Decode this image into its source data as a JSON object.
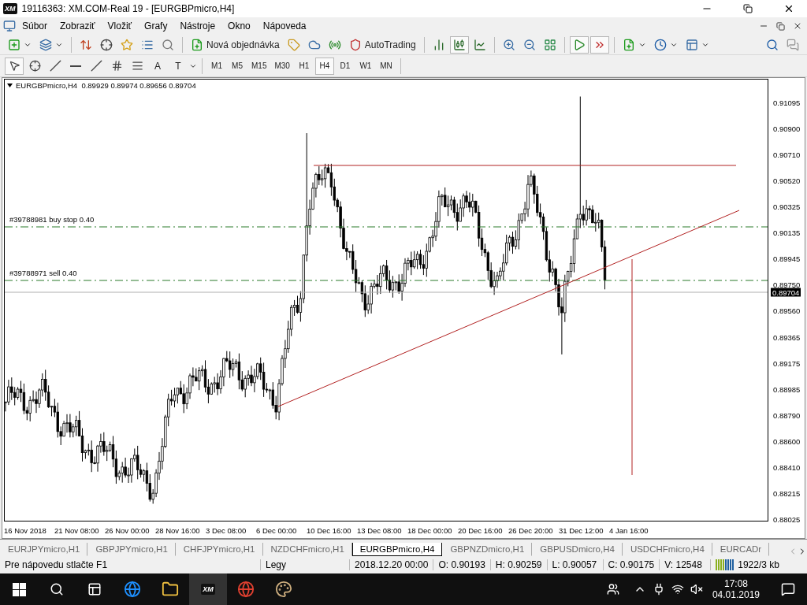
{
  "window": {
    "logo": "XM",
    "title": "19116363: XM.COM-Real 19 - [EURGBPmicro,H4]"
  },
  "menu": [
    "Súbor",
    "Zobraziť",
    "Vložiť",
    "Grafy",
    "Nástroje",
    "Okno",
    "Nápoveda"
  ],
  "toolbar": {
    "new_order": "Nová objednávka",
    "auto_trading": "AutoTrading"
  },
  "chart_types": [
    {
      "kind": "bars",
      "selected": false
    },
    {
      "kind": "candles",
      "selected": true
    },
    {
      "kind": "line",
      "selected": false
    }
  ],
  "drawing_tools": [
    {
      "kind": "cursor",
      "selected": true
    },
    {
      "kind": "crosshair",
      "selected": false
    },
    {
      "kind": "vline",
      "selected": false
    },
    {
      "kind": "hline",
      "selected": false
    },
    {
      "kind": "trend",
      "selected": false
    },
    {
      "kind": "channel",
      "selected": false
    },
    {
      "kind": "fibo",
      "selected": false
    },
    {
      "kind": "text",
      "label": "A",
      "selected": false
    },
    {
      "kind": "label",
      "label": "T",
      "selected": false
    }
  ],
  "timeframes": [
    {
      "label": "M1",
      "selected": false
    },
    {
      "label": "M5",
      "selected": false
    },
    {
      "label": "M15",
      "selected": false
    },
    {
      "label": "M30",
      "selected": false
    },
    {
      "label": "H1",
      "selected": false
    },
    {
      "label": "H4",
      "selected": true
    },
    {
      "label": "D1",
      "selected": false
    },
    {
      "label": "W1",
      "selected": false
    },
    {
      "label": "MN",
      "selected": false
    }
  ],
  "chart": {
    "symbol": "EURGBPmicro,H4",
    "ohlc": "0.89929 0.89974 0.89656 0.89704",
    "orders": [
      {
        "label": "#39788981 buy stop 0.40"
      },
      {
        "label": "#39788971 sell 0.40"
      }
    ],
    "price_ticks": [
      "0.91095",
      "0.90900",
      "0.90710",
      "0.90520",
      "0.90325",
      "0.90135",
      "0.89945",
      "0.89750",
      "0.89560",
      "0.89365",
      "0.89175",
      "0.88985",
      "0.88790",
      "0.88600",
      "0.88410",
      "0.88215",
      "0.88025"
    ],
    "current_price": "0.89704",
    "date_labels": [
      "16 Nov 2018",
      "21 Nov 08:00",
      "26 Nov 00:00",
      "28 Nov 16:00",
      "3 Dec 08:00",
      "6 Dec 00:00",
      "10 Dec 16:00",
      "13 Dec 08:00",
      "18 Dec 00:00",
      "20 Dec 16:00",
      "26 Dec 20:00",
      "31 Dec 12:00",
      "4 Jan 16:00"
    ]
  },
  "tabs": [
    {
      "label": "EURJPYmicro,H1",
      "selected": false
    },
    {
      "label": "GBPJPYmicro,H1",
      "selected": false
    },
    {
      "label": "CHFJPYmicro,H1",
      "selected": false
    },
    {
      "label": "NZDCHFmicro,H1",
      "selected": false
    },
    {
      "label": "EURGBPmicro,H4",
      "selected": true
    },
    {
      "label": "GBPNZDmicro,H1",
      "selected": false
    },
    {
      "label": "GBPUSDmicro,H4",
      "selected": false
    },
    {
      "label": "USDCHFmicro,H4",
      "selected": false
    },
    {
      "label": "EURCADr",
      "selected": false
    }
  ],
  "status_bar": {
    "help": "Pre nápovedu stlačte F1",
    "profile": "Legy",
    "date": "2018.12.20 00:00",
    "open": "O: 0.90193",
    "high": "H: 0.90259",
    "low": "L: 0.90057",
    "close": "C: 0.90175",
    "volume": "V: 12548",
    "traffic": "1922/3 kb"
  },
  "taskbar": {
    "app_logo": "XM",
    "time": "17:08",
    "date": "04.01.2019"
  }
}
